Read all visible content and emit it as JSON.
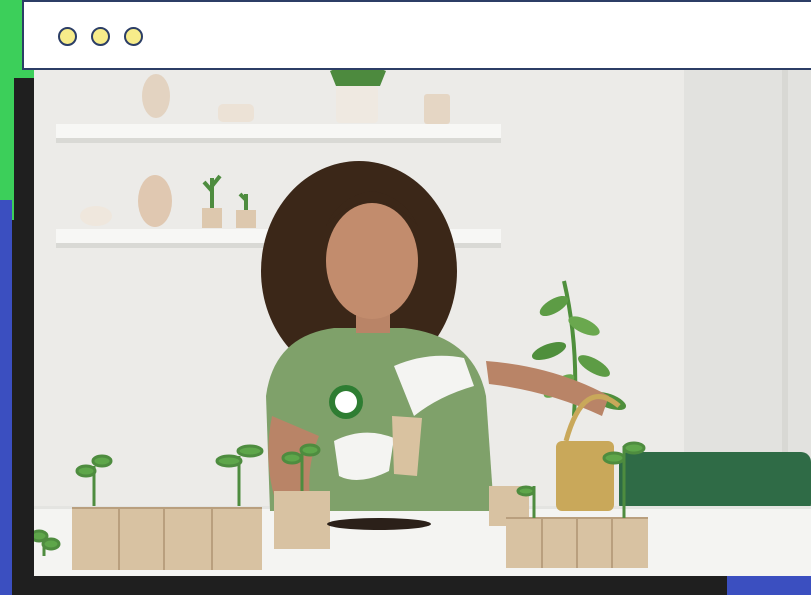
{
  "window": {
    "controls": [
      {
        "name": "window-control-dot-1",
        "color": "#f7ec8a"
      },
      {
        "name": "window-control-dot-2",
        "color": "#f7ec8a"
      },
      {
        "name": "window-control-dot-3",
        "color": "#f7ec8a"
      }
    ]
  },
  "colors": {
    "accent_green": "#3ccf5a",
    "accent_blue": "#3b4fc0",
    "frame_border": "#2c3e66",
    "background": "#1f1f1f"
  },
  "photo": {
    "subject": "woman-planting-seedlings-image"
  }
}
